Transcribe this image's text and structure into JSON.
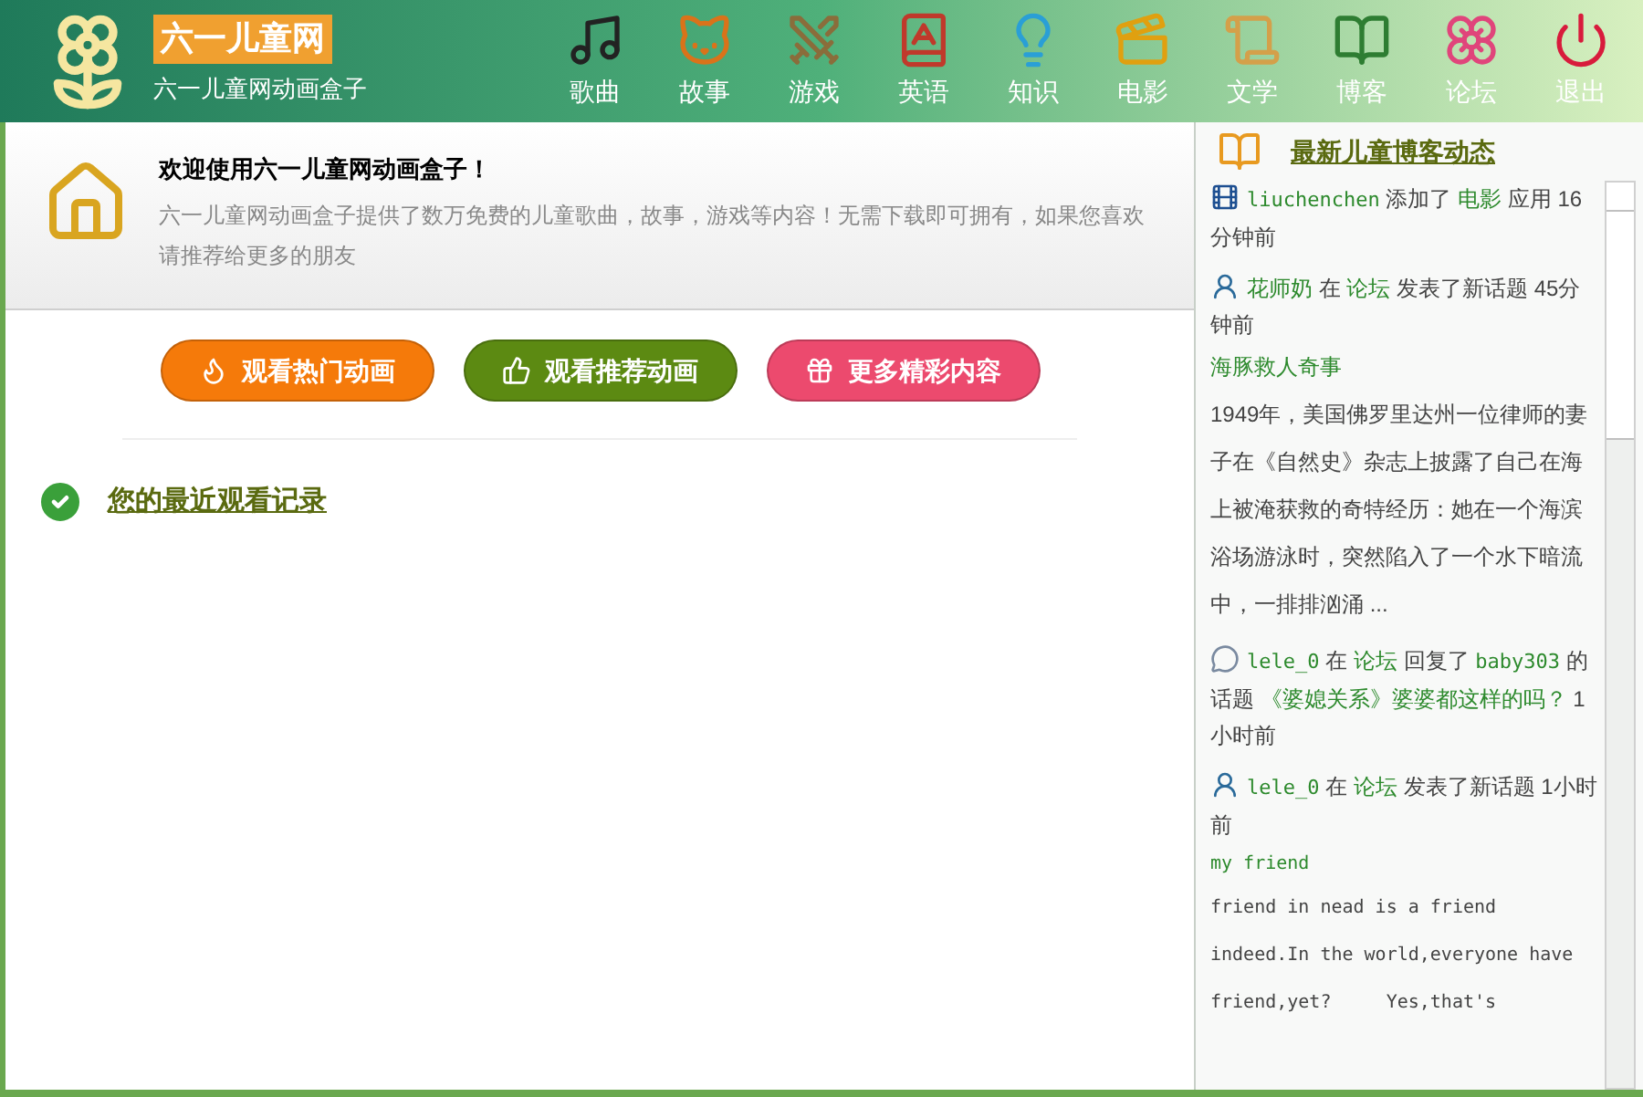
{
  "app": {
    "logo": "六一儿童网",
    "subtitle": "六一儿童网动画盒子"
  },
  "nav": [
    {
      "label": "歌曲"
    },
    {
      "label": "故事"
    },
    {
      "label": "游戏"
    },
    {
      "label": "英语"
    },
    {
      "label": "知识"
    },
    {
      "label": "电影"
    },
    {
      "label": "文学"
    },
    {
      "label": "博客"
    },
    {
      "label": "论坛"
    },
    {
      "label": "退出"
    }
  ],
  "welcome": {
    "title": "欢迎使用六一儿童网动画盒子！",
    "text": "六一儿童网动画盒子提供了数万免费的儿童歌曲，故事，游戏等内容！无需下载即可拥有，如果您喜欢请推荐给更多的朋友"
  },
  "actions": [
    {
      "label": "观看热门动画",
      "color": "#f57a0a"
    },
    {
      "label": "观看推荐动画",
      "color": "#5c8a12"
    },
    {
      "label": "更多精彩内容",
      "color": "#ec4a6e"
    }
  ],
  "history": {
    "title": "您的最近观看记录"
  },
  "feed": {
    "title": "最新儿童博客动态",
    "items": [
      {
        "segments": [
          {
            "text": "liuchenchen",
            "kind": "user"
          },
          {
            "text": " 添加了 ",
            "kind": "plain"
          },
          {
            "text": "电影",
            "kind": "link"
          },
          {
            "text": " 应用 16分钟前",
            "kind": "plain"
          }
        ]
      },
      {
        "segments": [
          {
            "text": "花师奶",
            "kind": "link"
          },
          {
            "text": " 在 ",
            "kind": "plain"
          },
          {
            "text": "论坛",
            "kind": "link"
          },
          {
            "text": " 发表了新话题 45分钟前",
            "kind": "plain"
          }
        ],
        "post_title": "海豚救人奇事",
        "excerpt": "1949年，美国佛罗里达州一位律师的妻子在《自然史》杂志上披露了自己在海上被淹获救的奇特经历：她在一个海滨浴场游泳时，突然陷入了一个水下暗流中，一排排汹涌 ..."
      },
      {
        "segments": [
          {
            "text": "lele_0",
            "kind": "user"
          },
          {
            "text": " 在 ",
            "kind": "plain"
          },
          {
            "text": "论坛",
            "kind": "link"
          },
          {
            "text": " 回复了 ",
            "kind": "plain"
          },
          {
            "text": "baby303",
            "kind": "user"
          },
          {
            "text": " 的话题 ",
            "kind": "plain"
          },
          {
            "text": "《婆媳关系》婆婆都这样的吗？",
            "kind": "link"
          },
          {
            "text": " 1小时前",
            "kind": "plain"
          }
        ]
      },
      {
        "segments": [
          {
            "text": "lele_0",
            "kind": "user"
          },
          {
            "text": " 在 ",
            "kind": "plain"
          },
          {
            "text": "论坛",
            "kind": "link"
          },
          {
            "text": " 发表了新话题 1小时前",
            "kind": "plain"
          }
        ],
        "post_title": "my friend",
        "excerpt": "friend in nead is a friend indeed.In the world,everyone have friend,yet?     Yes,that's",
        "mono": true
      }
    ]
  }
}
